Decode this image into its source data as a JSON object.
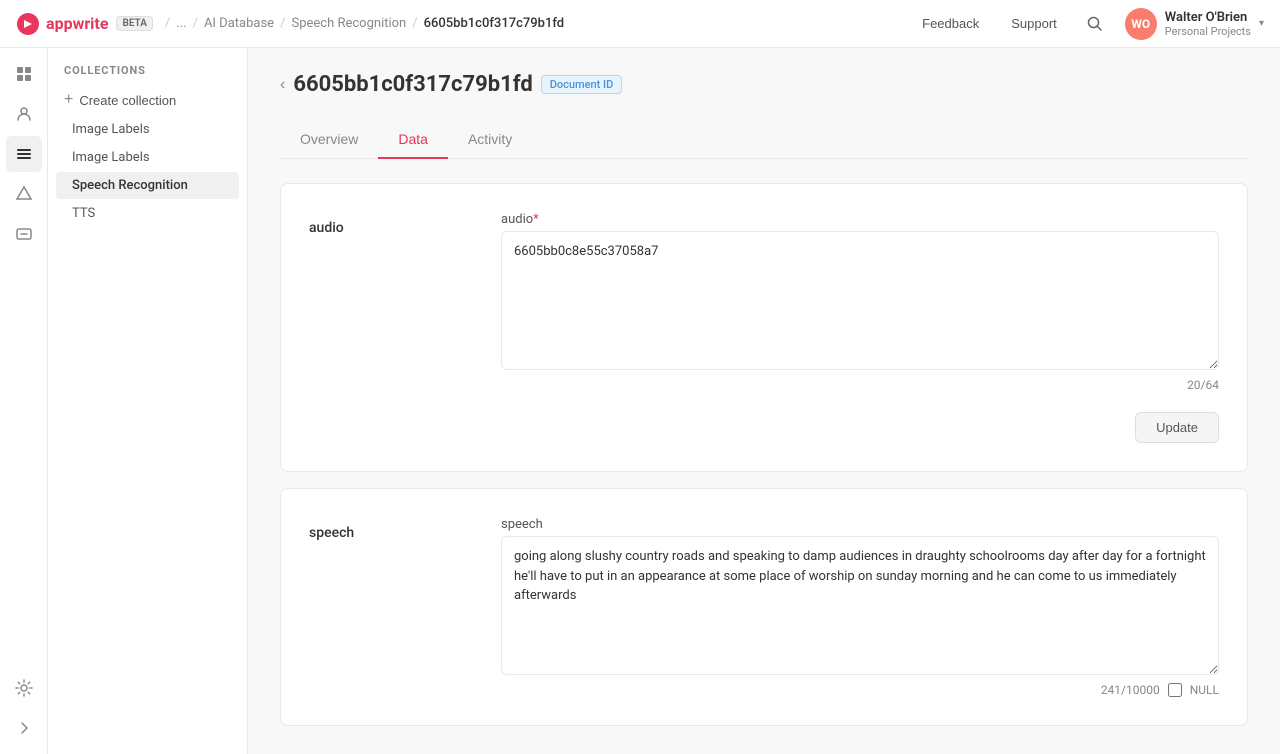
{
  "app": {
    "name": "appwrite",
    "beta_label": "BETA"
  },
  "breadcrumb": {
    "items": [
      "...",
      "AI Database",
      "Speech Recognition",
      "6605bb1c0f317c79b1fd"
    ]
  },
  "topbar": {
    "feedback_label": "Feedback",
    "support_label": "Support"
  },
  "user": {
    "initials": "WO",
    "name": "Walter O'Brien",
    "project": "Personal Projects"
  },
  "sidebar": {
    "section_title": "COLLECTIONS",
    "create_label": "Create collection",
    "items": [
      {
        "label": "Image Labels",
        "active": false
      },
      {
        "label": "Image Labels",
        "active": false
      },
      {
        "label": "Speech Recognition",
        "active": true
      },
      {
        "label": "TTS",
        "active": false
      }
    ]
  },
  "page": {
    "doc_id": "6605bb1c0f317c79b1fd",
    "doc_id_badge": "Document ID",
    "tabs": [
      {
        "label": "Overview",
        "active": false
      },
      {
        "label": "Data",
        "active": true
      },
      {
        "label": "Activity",
        "active": false
      }
    ]
  },
  "fields": [
    {
      "key": "audio",
      "label": "audio",
      "field_name": "audio",
      "required": true,
      "value": "6605bb0c8e55c37058a7",
      "char_count": "20/64",
      "rows": 6,
      "show_null": false,
      "show_update": true
    },
    {
      "key": "speech",
      "label": "speech",
      "field_name": "speech",
      "required": false,
      "value": "going along slushy country roads and speaking to damp audiences in draughty schoolrooms day after day for a fortnight he'll have to put in an appearance at some place of worship on sunday morning and he can come to us immediately afterwards",
      "char_count": "241/10000",
      "rows": 6,
      "show_null": true,
      "null_label": "NULL",
      "show_update": false
    }
  ],
  "icons": {
    "chart": "📊",
    "users": "👥",
    "list": "☰",
    "lightning": "⚡",
    "folder": "📁",
    "settings": "⚙",
    "arrow_right": "›",
    "search": "🔍"
  }
}
